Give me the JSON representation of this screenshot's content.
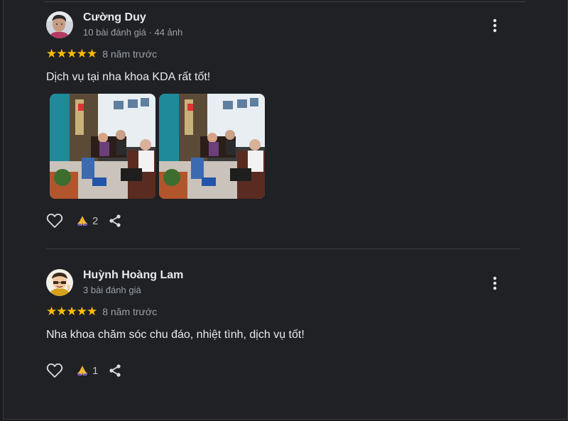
{
  "reviews": [
    {
      "author": "Cường Duy",
      "meta": "10 bài đánh giá · 44 ảnh",
      "stars": "★★★★★",
      "time": "8 năm trước",
      "text": "Dịch vụ tại nha khoa KDA rất tốt!",
      "photos": 2,
      "likes": "2",
      "avatar_icon": "man-portrait-icon"
    },
    {
      "author": "Huỳnh Hoàng Lam",
      "meta": "3 bài đánh giá",
      "stars": "★★★★★",
      "time": "8 năm trước",
      "text": "Nha khoa chăm sóc chu đáo, nhiệt tình, dịch vụ tốt!",
      "likes": "1",
      "avatar_icon": "cartoon-character-icon"
    }
  ],
  "colors": {
    "background": "#202124",
    "text": "#e8eaed",
    "secondary": "#9aa0a6",
    "star": "#fbbc04",
    "divider": "#3c4043"
  }
}
